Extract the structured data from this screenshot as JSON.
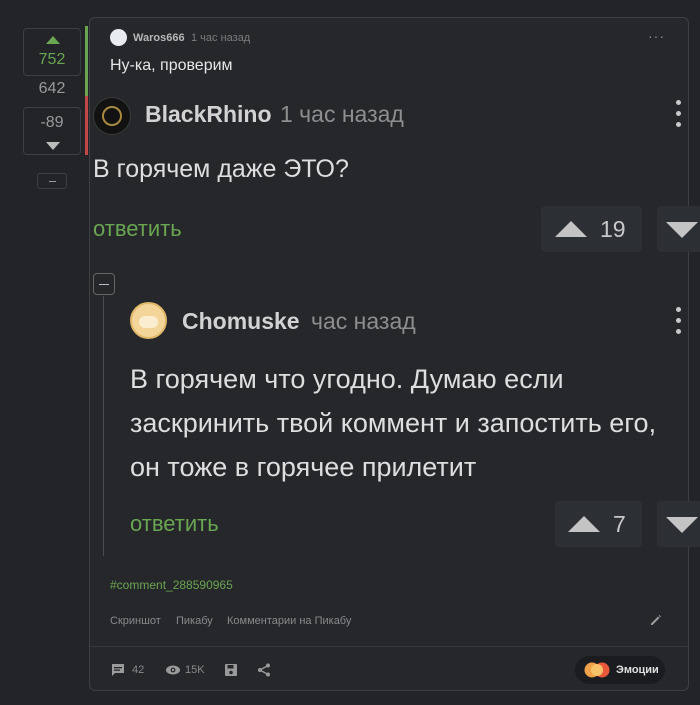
{
  "votes": {
    "plus": "752",
    "total": "642",
    "minus": "-89"
  },
  "top": {
    "author": "Waros666",
    "time": "1 час назад",
    "text": "Ну-ка, проверим",
    "more": "···"
  },
  "quoted": {
    "author": "BlackRhino",
    "time": "1 час назад",
    "text": "В горячем даже ЭТО?",
    "reply_label": "ответить",
    "rating": "19"
  },
  "reply": {
    "author": "Chomuske",
    "time": "час назад",
    "text": "В горячем что угодно. Думаю если заскринить твой коммент и запостить его, он тоже в горячее прилетит",
    "reply_label": "ответить",
    "rating": "7"
  },
  "comment_link": "#comment_288590965",
  "footer_links": [
    "Скриншот",
    "Пикабу",
    "Комментарии на Пикабу"
  ],
  "stats": {
    "comments": "42",
    "views": "15K"
  },
  "emotions_label": "Эмоции",
  "colors": {
    "accent_green": "#6aa551",
    "accent_red": "#c44747",
    "background": "#222428"
  },
  "icons": [
    "chevron-up-icon",
    "chevron-down-icon",
    "more-icon",
    "kebab-icon",
    "pencil-icon",
    "comment-icon",
    "eye-icon",
    "save-icon",
    "share-icon"
  ]
}
